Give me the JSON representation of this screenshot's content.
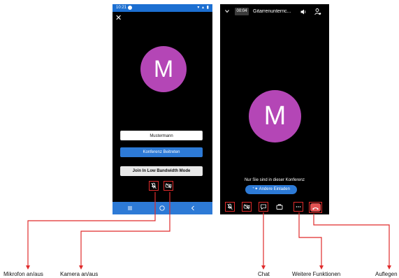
{
  "left_phone": {
    "status_time": "10:21",
    "status_right": "▾ ▴ ▮",
    "close_symbol": "✕",
    "avatar_letter": "M",
    "name_value": "Mustermann",
    "join_label": "Konferenz Beitreten",
    "low_bandwidth_label": "Join In Low Bandwidth Mode",
    "mic_icon": "mic-off-icon",
    "camera_icon": "camera-off-icon",
    "nav_icons": [
      "recents-icon",
      "home-icon",
      "back-icon"
    ]
  },
  "right_phone": {
    "timer": "00:04",
    "title": "Gitarrenunterric...",
    "avatar_letter": "M",
    "only_you_text": "Nur Sie sind in dieser Konferenz",
    "invite_label": "Andere Einladen",
    "controls": [
      "mic-off-icon",
      "camera-off-icon",
      "chat-icon",
      "briefcase-icon",
      "more-icon",
      "hangup-icon"
    ]
  },
  "annotations": {
    "mic": "Mikrofon an/aus",
    "camera": "Kamera an/aus",
    "chat": "Chat",
    "more": "Weitere Funktionen",
    "hangup": "Auflegen"
  },
  "colors": {
    "accent_blue": "#2d7ad6",
    "avatar_purple": "#b446b6",
    "annotation_red": "#e02b2b",
    "hangup_red": "#e05252"
  }
}
